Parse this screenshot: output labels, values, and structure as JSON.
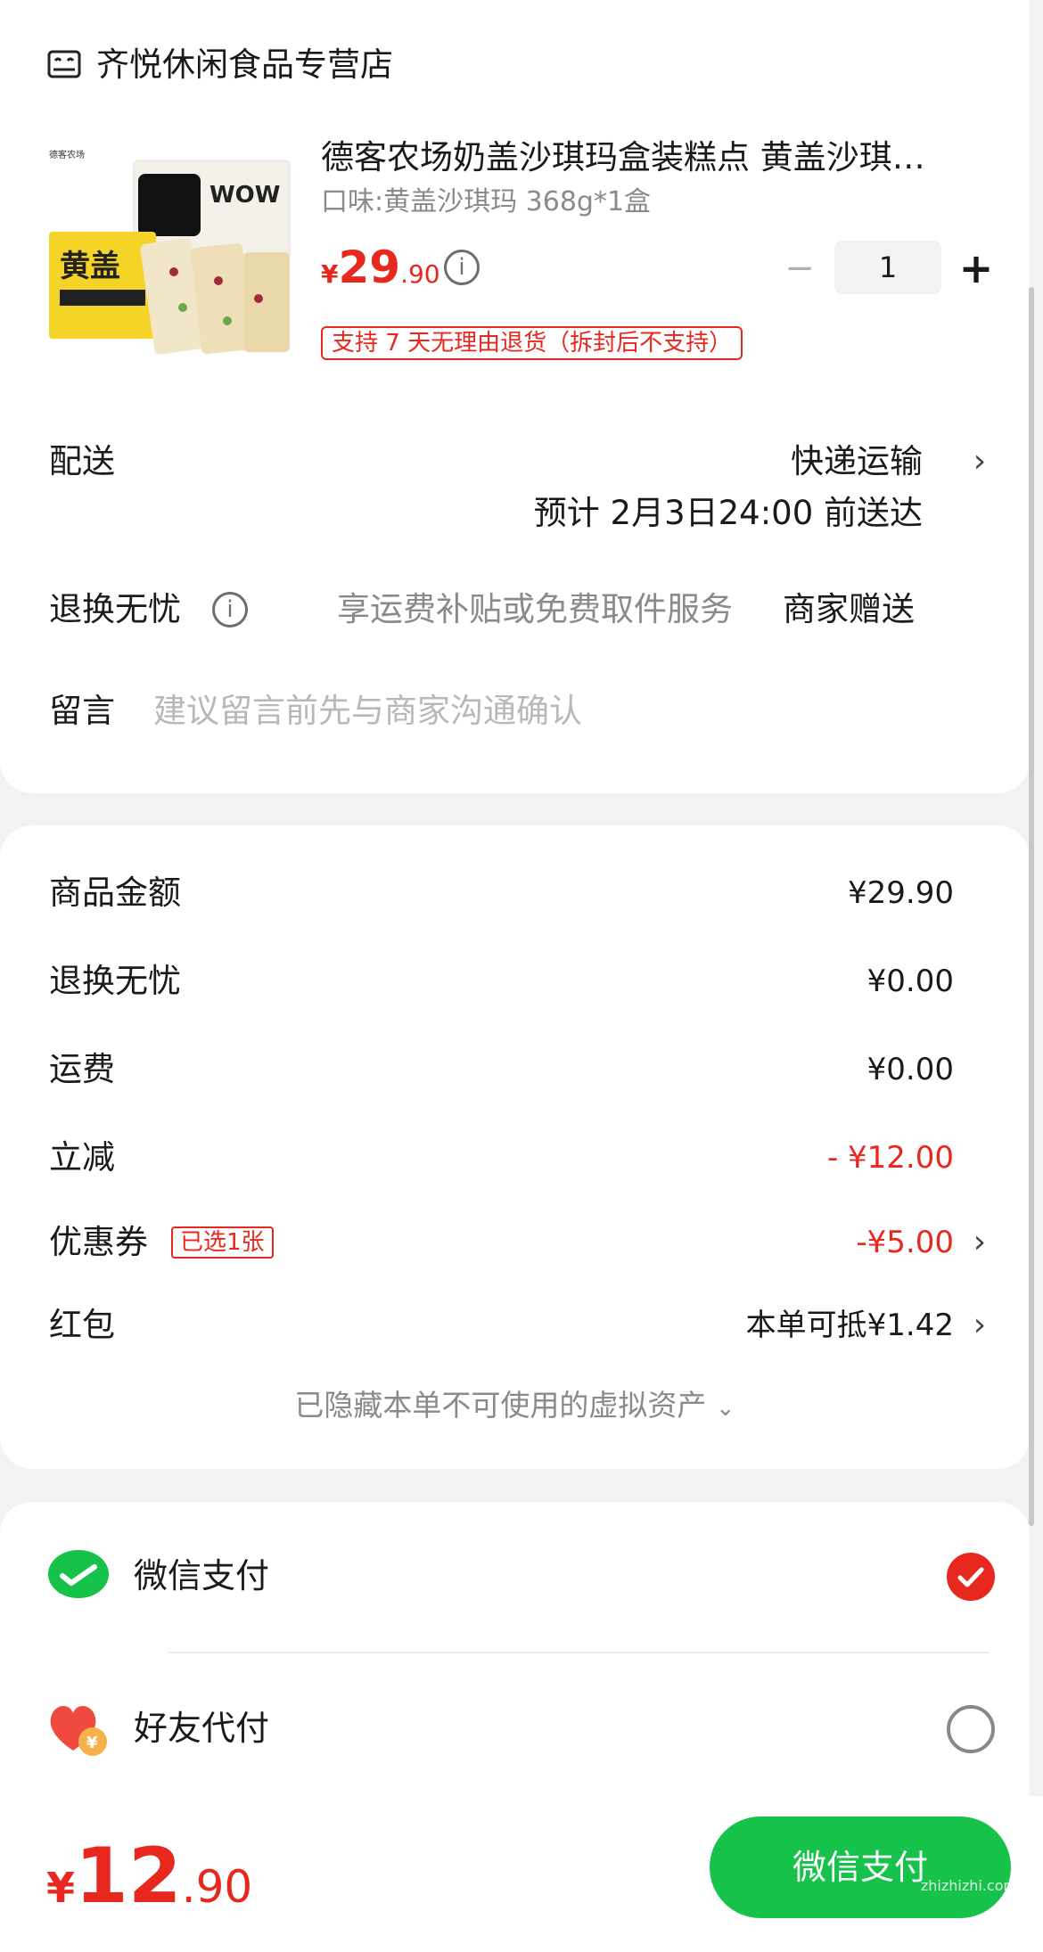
{
  "store": {
    "name": "齐悦休闲食品专营店",
    "icon": "store-icon"
  },
  "product": {
    "title": "德客农场奶盖沙琪玛盒装糕点 黄盖沙琪…",
    "spec": "口味:黄盖沙琪玛 368g*1盒",
    "price_currency": "¥",
    "price_int": "29",
    "price_dec": ".90",
    "info_icon_glyph": "i",
    "quantity": "1",
    "minus_glyph": "−",
    "plus_glyph": "+",
    "return_tag": "支持 7 天无理由退货（拆封后不支持）",
    "image_brand": "德客农场",
    "image_text_top": "WOW",
    "image_text_bottom": "黄盖"
  },
  "delivery": {
    "label": "配送",
    "method": "快递运输",
    "eta": "预计 2月3日24:00 前送达"
  },
  "return_worry_free": {
    "label": "退换无忧",
    "desc": "享运费补贴或免费取件服务",
    "gift": "商家赠送"
  },
  "message": {
    "label": "留言",
    "placeholder": "建议留言前先与商家沟通确认"
  },
  "summary": {
    "goods_amount_label": "商品金额",
    "goods_amount": "¥29.90",
    "return_fee_label": "退换无忧",
    "return_fee": "¥0.00",
    "shipping_label": "运费",
    "shipping": "¥0.00",
    "instant_discount_label": "立减",
    "instant_discount": "- ¥12.00",
    "coupon_label": "优惠券",
    "coupon_tag": "已选1张",
    "coupon_amount": "-¥5.00",
    "red_packet_label": "红包",
    "red_packet_amount": "本单可抵¥1.42",
    "hidden_assets": "已隐藏本单不可使用的虚拟资产"
  },
  "payment": {
    "wechat_label": "微信支付",
    "friend_label": "好友代付",
    "selected": "wechat",
    "wechat_icon": "wechat-pay-icon",
    "friend_icon": "friend-pay-icon"
  },
  "footer": {
    "total_currency": "¥",
    "total_int": "12",
    "total_dec": ".90",
    "pay_button": "微信支付",
    "watermark": "zhizhizhi.com"
  },
  "colors": {
    "accent_red": "#e8281e",
    "wechat_green": "#16c24a"
  }
}
